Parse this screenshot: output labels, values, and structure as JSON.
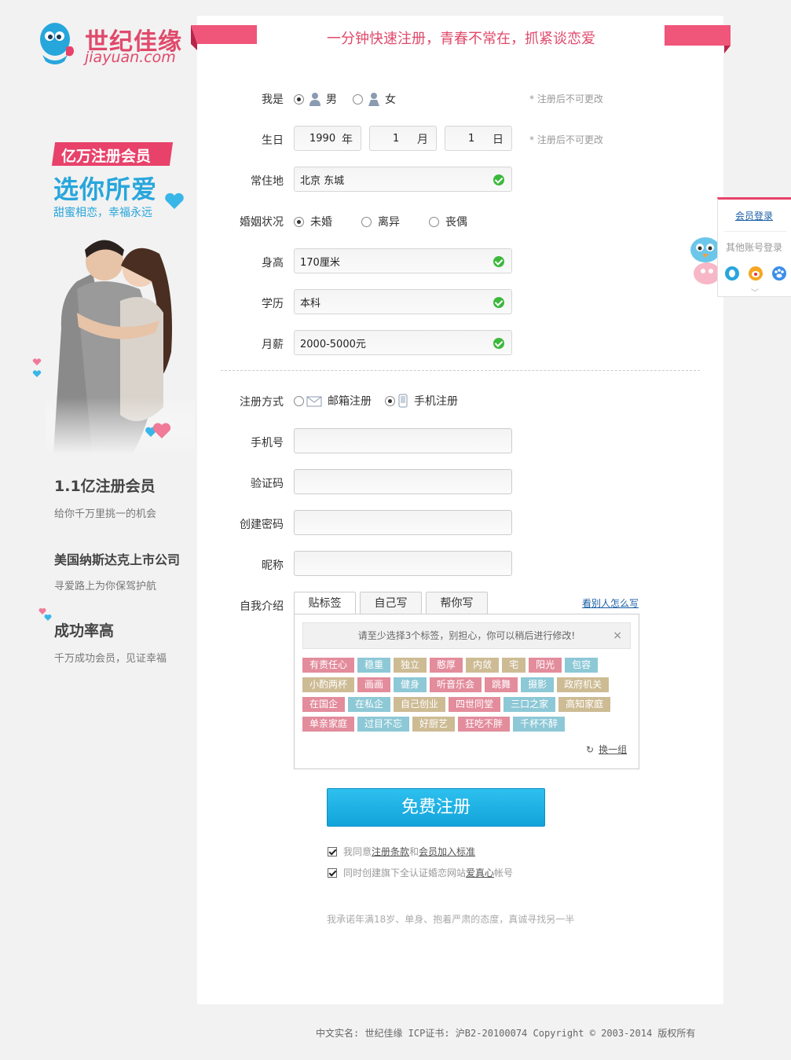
{
  "logo": {
    "cn": "世纪佳缘",
    "en": "jiayuan.com"
  },
  "promo": {
    "ribbon": "亿万注册会员",
    "big": "选你所爱",
    "small": "甜蜜相恋，幸福永远"
  },
  "stats": [
    {
      "title": "1.1亿注册会员",
      "sub": "给你千万里挑一的机会"
    },
    {
      "title": "美国纳斯达克上市公司",
      "sub": "寻爱路上为你保驾护航"
    },
    {
      "title": "成功率高",
      "sub": "千万成功会员，见证幸福"
    }
  ],
  "slogan": "一分钟快速注册，青春不常在，抓紧谈恋爱",
  "form": {
    "gender": {
      "label": "我是",
      "male": "男",
      "female": "女",
      "selected": "男",
      "note": "* 注册后不可更改"
    },
    "birthday": {
      "label": "生日",
      "year": "1990",
      "year_unit": "年",
      "month": "1",
      "month_unit": "月",
      "day": "1",
      "day_unit": "日",
      "note": "* 注册后不可更改"
    },
    "residence": {
      "label": "常住地",
      "value": "北京 东城"
    },
    "marital": {
      "label": "婚姻状况",
      "options": [
        "未婚",
        "离异",
        "丧偶"
      ],
      "selected": "未婚"
    },
    "height": {
      "label": "身高",
      "value": "170厘米"
    },
    "education": {
      "label": "学历",
      "value": "本科"
    },
    "salary": {
      "label": "月薪",
      "value": "2000-5000元"
    },
    "reg_method": {
      "label": "注册方式",
      "email": "邮箱注册",
      "phone": "手机注册",
      "selected": "手机注册"
    },
    "phone": {
      "label": "手机号",
      "value": ""
    },
    "code": {
      "label": "验证码",
      "value": ""
    },
    "password": {
      "label": "创建密码",
      "value": ""
    },
    "nickname": {
      "label": "昵称",
      "value": ""
    },
    "intro": {
      "label": "自我介绍",
      "tabs": [
        "贴标签",
        "自己写",
        "帮你写"
      ],
      "active_tab": "贴标签",
      "how_link": "看别人怎么写",
      "tip": "请至少选择3个标签，别担心，你可以稍后进行修改!",
      "close": "×",
      "tag_rows": [
        [
          {
            "t": "有责任心",
            "c": "c1"
          },
          {
            "t": "稳重",
            "c": "c2"
          },
          {
            "t": "独立",
            "c": "c3"
          },
          {
            "t": "憨厚",
            "c": "c1"
          },
          {
            "t": "内敛",
            "c": "c3"
          },
          {
            "t": "宅",
            "c": "c3"
          },
          {
            "t": "阳光",
            "c": "c1"
          },
          {
            "t": "包容",
            "c": "c2"
          }
        ],
        [
          {
            "t": "小酌两杯",
            "c": "c3"
          },
          {
            "t": "画画",
            "c": "c1"
          },
          {
            "t": "健身",
            "c": "c2"
          },
          {
            "t": "听音乐会",
            "c": "c1"
          },
          {
            "t": "跳舞",
            "c": "c1"
          },
          {
            "t": "摄影",
            "c": "c2"
          },
          {
            "t": "政府机关",
            "c": "c3"
          }
        ],
        [
          {
            "t": "在国企",
            "c": "c1"
          },
          {
            "t": "在私企",
            "c": "c2"
          },
          {
            "t": "自己创业",
            "c": "c3"
          },
          {
            "t": "四世同堂",
            "c": "c1"
          },
          {
            "t": "三口之家",
            "c": "c2"
          },
          {
            "t": "高知家庭",
            "c": "c3"
          }
        ],
        [
          {
            "t": "单亲家庭",
            "c": "c1"
          },
          {
            "t": "过目不忘",
            "c": "c2"
          },
          {
            "t": "好厨艺",
            "c": "c3"
          },
          {
            "t": "狂吃不胖",
            "c": "c1"
          },
          {
            "t": "千杯不醉",
            "c": "c2"
          }
        ]
      ],
      "swap": "换一组"
    },
    "submit": "免费注册",
    "agree1": {
      "pre": "我同意",
      "link1": "注册条款",
      "mid": "和",
      "link2": "会员加入标准",
      "checked": true
    },
    "agree2": {
      "pre": "同时创建旗下全认证婚恋网站",
      "link": "爱真心",
      "post": "帐号",
      "checked": true
    },
    "pledge": "我承诺年满18岁、单身、抱着严肃的态度，真诚寻找另一半"
  },
  "floater": {
    "login": "会员登录",
    "other": "其他账号登录",
    "icons": [
      "qq-icon",
      "weibo-icon",
      "baidu-icon"
    ]
  },
  "footer": "中文实名: 世纪佳缘 ICP证书: 沪B2-20100074 Copyright © 2003-2014 版权所有",
  "colors": {
    "brand_pink": "#e8426a",
    "brand_blue": "#27a6dc",
    "submit_blue": "#12a3da"
  }
}
